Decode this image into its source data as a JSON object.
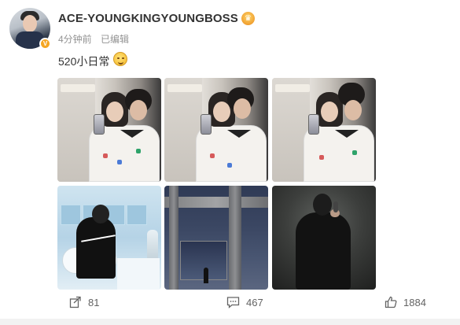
{
  "post": {
    "username": "ACE-YOUNGKINGYOUNGBOSS",
    "time": "4分钟前",
    "edited": "已编辑",
    "text": "520小日常"
  },
  "badges": {
    "verified_color": "#f5a623",
    "crown_icon": "crown-icon",
    "emoji": "smile-emoji-icon"
  },
  "actions": {
    "share_count": "81",
    "comment_count": "467",
    "like_count": "1884"
  },
  "colors": {
    "text_primary": "#333333",
    "text_meta": "#939393",
    "action_text": "#636363"
  }
}
